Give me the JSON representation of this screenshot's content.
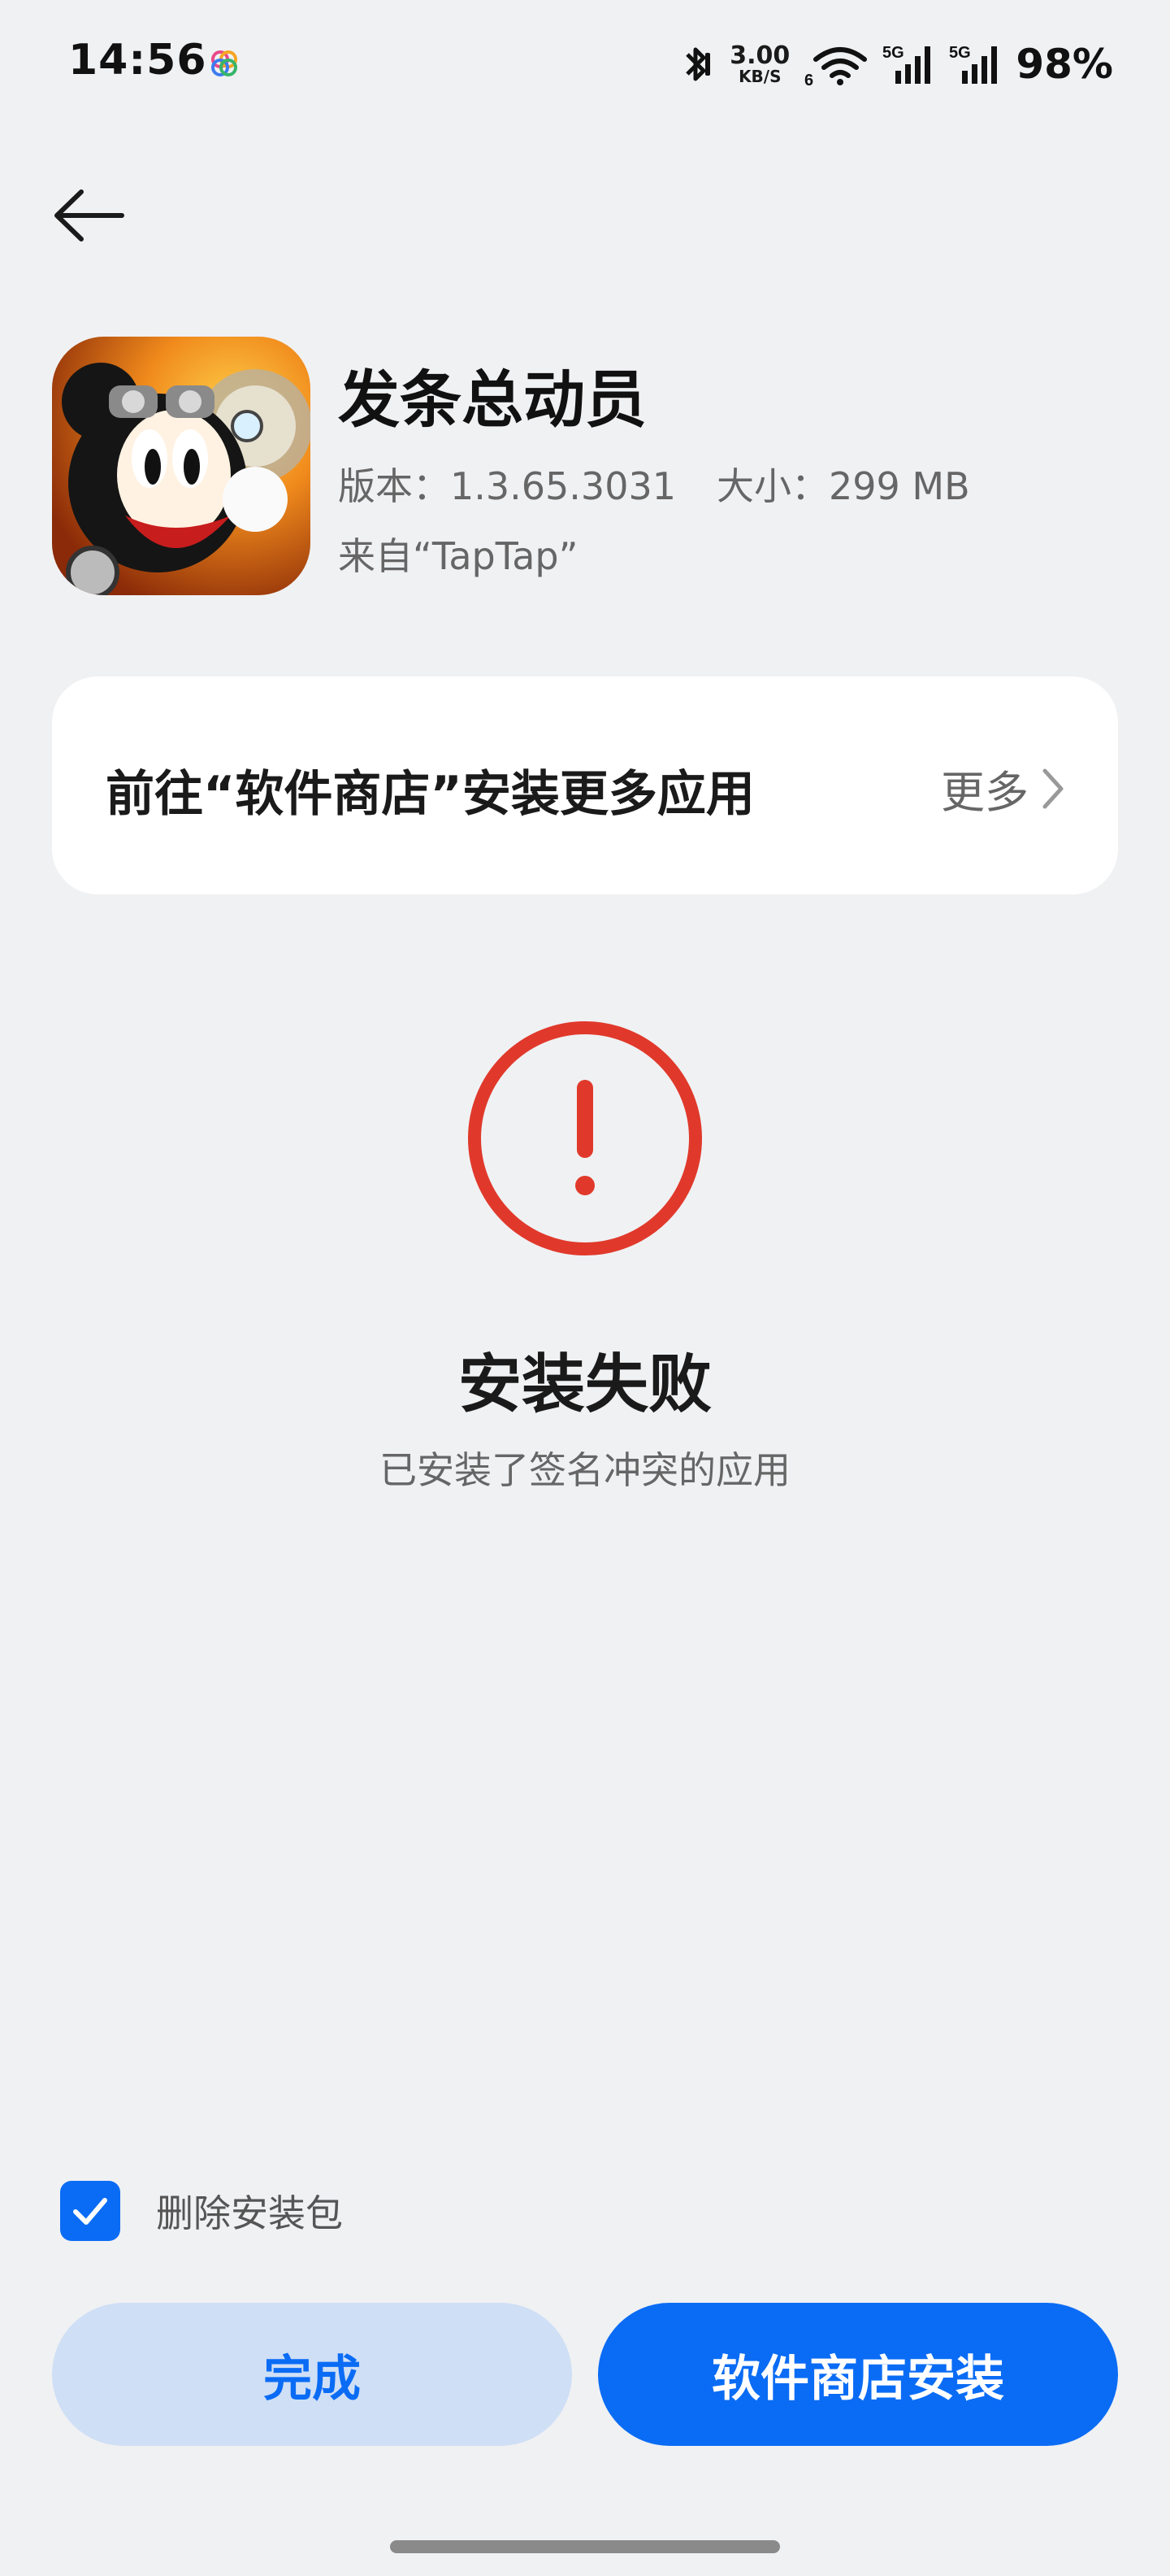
{
  "status_bar": {
    "time": "14:56",
    "net_speed_value": "3.00",
    "net_speed_unit": "KB/S",
    "wifi_badge": "6",
    "signal1_label": "5G",
    "signal2_label": "5G",
    "battery": "98%"
  },
  "app": {
    "name": "发条总动员",
    "version": "版本：1.3.65.3031",
    "size": "大小：299 MB",
    "source": "来自“TapTap”"
  },
  "store_card": {
    "title": "前往“软件商店”安装更多应用",
    "more": "更多"
  },
  "result": {
    "title": "安装失败",
    "message": "已安装了签名冲突的应用",
    "accent_color": "#e0392b"
  },
  "options": {
    "delete_package_label": "删除安装包",
    "delete_package_checked": true
  },
  "buttons": {
    "done": "完成",
    "store_install": "软件商店安装"
  },
  "colors": {
    "primary": "#0a6cf5",
    "background": "#f0f1f3",
    "error": "#e0392b"
  }
}
